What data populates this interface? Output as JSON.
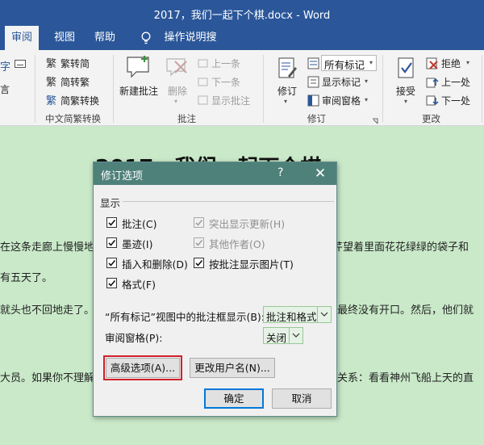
{
  "window": {
    "title": "2017，我们一起下个棋.docx  -  Word"
  },
  "tabs": [
    {
      "label": "审阅",
      "active": true
    },
    {
      "label": "视图",
      "active": false
    },
    {
      "label": "帮助",
      "active": false
    }
  ],
  "tell_me": "操作说明搜索",
  "ribbon": {
    "partial_left": {
      "top": "字",
      "bottom": "言"
    },
    "chinese": {
      "items": [
        "繁转简",
        "简转繁",
        "简繁转换"
      ],
      "group": "中文简繁转换"
    },
    "comments": {
      "new": "新建批注",
      "delete": "删除",
      "prev": "上一条",
      "next": "下一条",
      "show": "显示批注",
      "group": "批注"
    },
    "tracking": {
      "track": "修订",
      "markup": "所有标记",
      "show_markup": "显示标记",
      "pane": "审阅窗格",
      "group": "修订"
    },
    "changes": {
      "accept": "接受",
      "reject": "拒绝",
      "prev": "上一处",
      "next": "下一处",
      "group": "更改"
    }
  },
  "document": {
    "heading": "2017，我们一起下个棋",
    "lines": [
      "在这条走廊上慢慢地",
      "芹望着里面花花绿绿的袋子和",
      "有五天了。",
      "就头也不回地走了。",
      "最终没有开口。然后，他们就",
      "大员。如果你不理解",
      "关系：看看神州飞船上天的直"
    ]
  },
  "dialog": {
    "title": "修订选项",
    "help": "?",
    "close": "✕",
    "section": "显示",
    "checkboxes": [
      {
        "label": "批注(C)",
        "checked": true,
        "enabled": true
      },
      {
        "label": "突出显示更新(H)",
        "checked": true,
        "enabled": false
      },
      {
        "label": "墨迹(I)",
        "checked": true,
        "enabled": true
      },
      {
        "label": "其他作者(O)",
        "checked": true,
        "enabled": false
      },
      {
        "label": "插入和删除(D)",
        "checked": true,
        "enabled": true
      },
      {
        "label": "按批注显示图片(T)",
        "checked": true,
        "enabled": true
      },
      {
        "label": "格式(F)",
        "checked": true,
        "enabled": true
      }
    ],
    "balloon_label": "“所有标记”视图中的批注框显示(B):",
    "balloon_value": "批注和格式",
    "pane_label": "审阅窗格(P):",
    "pane_value": "关闭",
    "advanced_btn": "高级选项(A)...",
    "username_btn": "更改用户名(N)...",
    "ok_btn": "确定",
    "cancel_btn": "取消"
  }
}
